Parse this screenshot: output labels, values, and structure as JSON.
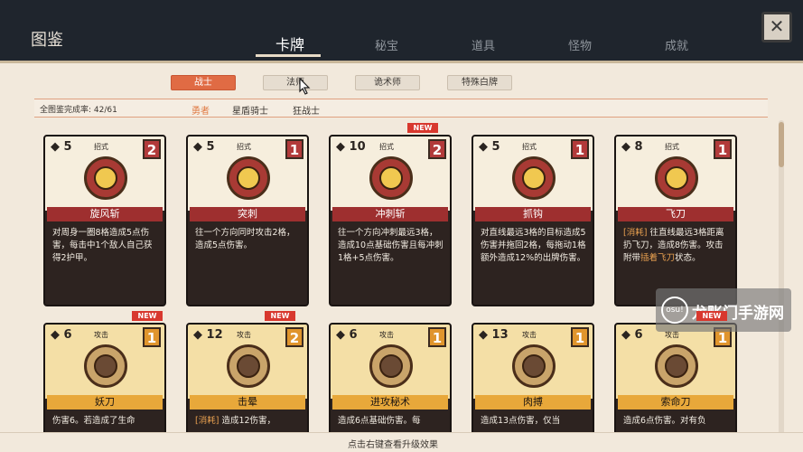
{
  "window": {
    "title": "图鉴"
  },
  "tabs": [
    {
      "label": "卡牌",
      "active": true
    },
    {
      "label": "秘宝",
      "active": false
    },
    {
      "label": "道具",
      "active": false
    },
    {
      "label": "怪物",
      "active": false
    },
    {
      "label": "成就",
      "active": false
    }
  ],
  "close_label": "✕",
  "classes": [
    {
      "label": "战士",
      "active": true
    },
    {
      "label": "法师",
      "active": false
    },
    {
      "label": "诡术师",
      "active": false
    },
    {
      "label": "特殊白牌",
      "active": false
    }
  ],
  "progress": {
    "label": "全图鉴完成率: 42/61",
    "value": 42,
    "total": 61
  },
  "subclasses": [
    {
      "label": "勇者",
      "active": true
    },
    {
      "label": "星盾骑士",
      "active": false
    },
    {
      "label": "狂战士",
      "active": false
    }
  ],
  "new_badge": "NEW",
  "cards": [
    {
      "name": "旋风斩",
      "cost": "5",
      "type": "招式",
      "level": "2",
      "kind": "skill",
      "is_new": false,
      "desc_tag": "",
      "desc": "对周身一圈8格造成5点伤害，每击中1个敌人自己获得2护甲。",
      "desc_hl": "",
      "desc_tail": ""
    },
    {
      "name": "突刺",
      "cost": "5",
      "type": "招式",
      "level": "1",
      "kind": "skill",
      "is_new": false,
      "desc_tag": "",
      "desc": "往一个方向同时攻击2格，造成5点伤害。",
      "desc_hl": "",
      "desc_tail": ""
    },
    {
      "name": "冲刺斩",
      "cost": "10",
      "type": "招式",
      "level": "2",
      "kind": "skill",
      "is_new": true,
      "desc_tag": "",
      "desc": "往一个方向冲刺最远3格，造成10点基础伤害且每冲刺1格+5点伤害。",
      "desc_hl": "",
      "desc_tail": ""
    },
    {
      "name": "抓钩",
      "cost": "5",
      "type": "招式",
      "level": "1",
      "kind": "skill",
      "is_new": false,
      "desc_tag": "",
      "desc": "对直线最远3格的目标造成5伤害并拖回2格，每拖动1格额外造成12%的出牌伤害。",
      "desc_hl": "",
      "desc_tail": ""
    },
    {
      "name": "飞刀",
      "cost": "8",
      "type": "招式",
      "level": "1",
      "kind": "skill",
      "is_new": false,
      "desc_tag": "[消耗]",
      "desc": "往直线最远3格距离扔飞刀，造成8伤害。攻击附带",
      "desc_hl": "插着飞刀",
      "desc_tail": "状态。"
    },
    {
      "name": "妖刀",
      "cost": "6",
      "type": "攻击",
      "level": "1",
      "kind": "atk",
      "is_new": true,
      "desc_tag": "",
      "desc": "伤害6。若造成了生命",
      "desc_hl": "",
      "desc_tail": ""
    },
    {
      "name": "击晕",
      "cost": "12",
      "type": "攻击",
      "level": "2",
      "kind": "atk",
      "is_new": true,
      "desc_tag": "[消耗]",
      "desc": "造成12伤害，",
      "desc_hl": "",
      "desc_tail": ""
    },
    {
      "name": "进攻秘术",
      "cost": "6",
      "type": "攻击",
      "level": "1",
      "kind": "atk",
      "is_new": false,
      "desc_tag": "",
      "desc": "造成6点基础伤害。每",
      "desc_hl": "",
      "desc_tail": ""
    },
    {
      "name": "肉搏",
      "cost": "13",
      "type": "攻击",
      "level": "1",
      "kind": "atk",
      "is_new": false,
      "desc_tag": "",
      "desc": "造成13点伤害，仅当",
      "desc_hl": "",
      "desc_tail": ""
    },
    {
      "name": "索命刀",
      "cost": "6",
      "type": "攻击",
      "level": "1",
      "kind": "atk",
      "is_new": true,
      "desc_tag": "",
      "desc": "造成6点伤害。对有负",
      "desc_hl": "",
      "desc_tail": ""
    }
  ],
  "footer_hint": "点击右键查看升级效果",
  "watermark": {
    "logo": "osu!",
    "text": "龙账门手游网"
  }
}
